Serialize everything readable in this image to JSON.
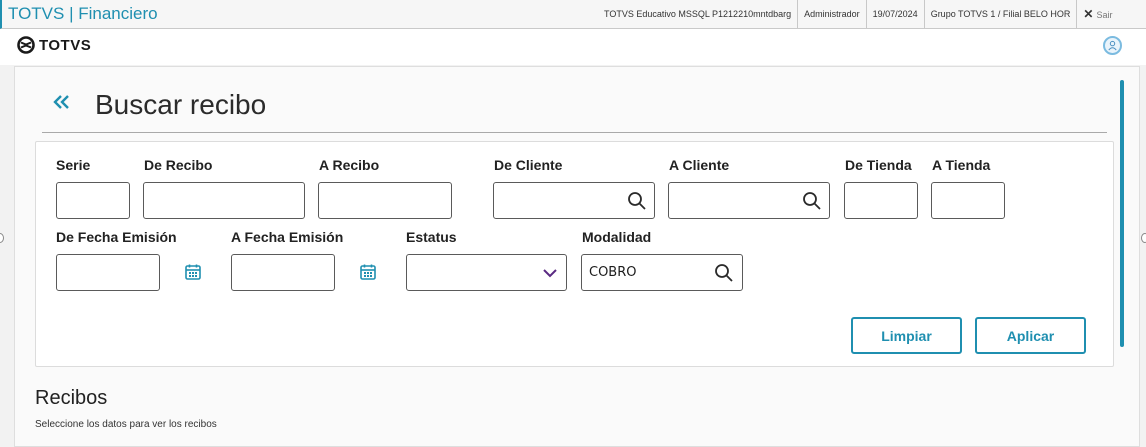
{
  "window": {
    "title": "TOTVS | Financiero",
    "environment": "TOTVS Educativo MSSQL P1212210mntdbarg",
    "user": "Administrador",
    "date": "19/07/2024",
    "branch": "Grupo TOTVS 1 / Filial BELO HOR",
    "exit_label": "Sair"
  },
  "header": {
    "brand": "TOTVS"
  },
  "page": {
    "title": "Buscar recibo"
  },
  "filters": {
    "serie": {
      "label": "Serie",
      "value": ""
    },
    "de_recibo": {
      "label": "De Recibo",
      "value": ""
    },
    "a_recibo": {
      "label": "A Recibo",
      "value": ""
    },
    "de_cliente": {
      "label": "De Cliente",
      "value": ""
    },
    "a_cliente": {
      "label": "A Cliente",
      "value": ""
    },
    "de_tienda": {
      "label": "De Tienda",
      "value": ""
    },
    "a_tienda": {
      "label": "A Tienda",
      "value": ""
    },
    "de_fecha": {
      "label": "De Fecha Emisión",
      "value": ""
    },
    "a_fecha": {
      "label": "A Fecha Emisión",
      "value": ""
    },
    "estatus": {
      "label": "Estatus",
      "value": ""
    },
    "modalidad": {
      "label": "Modalidad",
      "value": "COBRO"
    },
    "clear_label": "Limpiar",
    "apply_label": "Aplicar"
  },
  "results": {
    "title": "Recibos",
    "subtitle": "Seleccione los datos para ver los recibos"
  },
  "colors": {
    "accent": "#1f8fb0",
    "chevron": "#5a2a82"
  }
}
